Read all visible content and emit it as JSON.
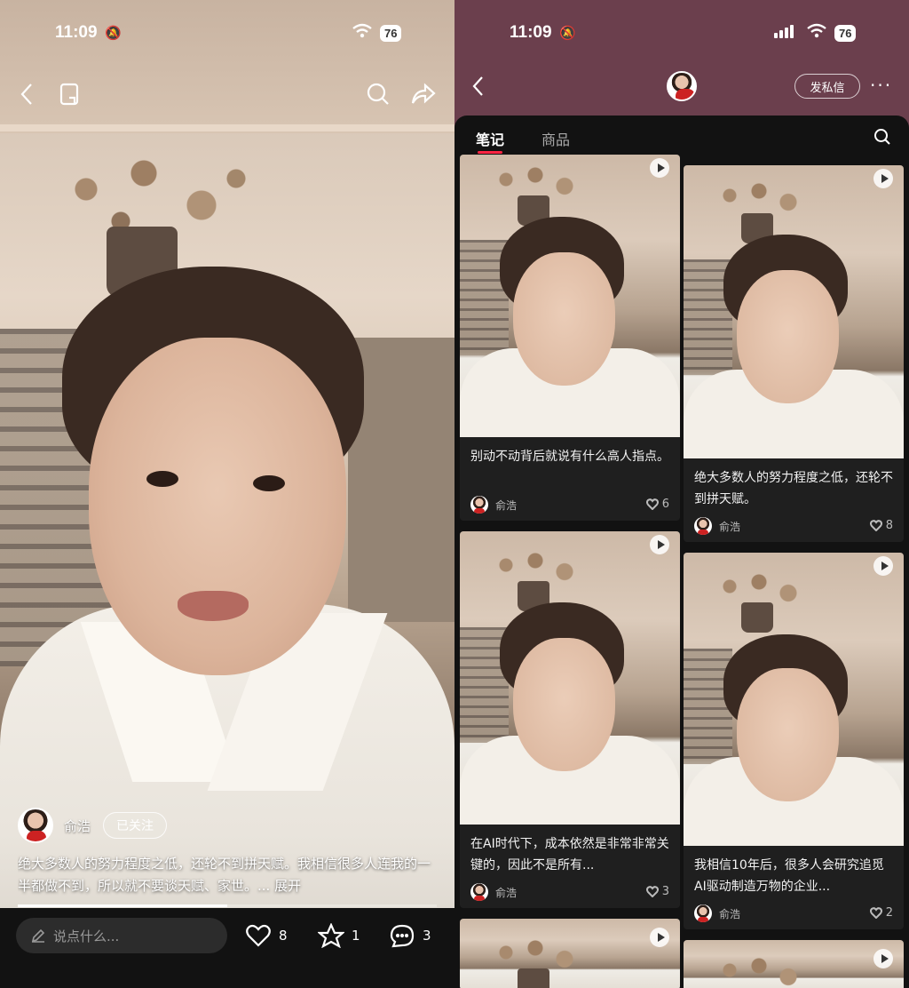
{
  "left": {
    "status": {
      "time": "11:09",
      "battery": "76"
    },
    "author": {
      "name": "俞浩",
      "follow_label": "已关注"
    },
    "description": "绝大多数人的努力程度之低，还轮不到拼天赋。我相信很多人连我的一半都做不到，所以就不要谈天赋、家世。... 展开",
    "progress": 0.5,
    "comment_placeholder": "说点什么...",
    "actions": {
      "likes": "8",
      "collects": "1",
      "comments": "3"
    }
  },
  "right": {
    "status": {
      "time": "11:09",
      "battery": "76"
    },
    "header": {
      "dm_label": "发私信",
      "more": "···"
    },
    "tabs": [
      {
        "label": "笔记"
      },
      {
        "label": "商品"
      }
    ],
    "cards": [
      {
        "title": "别动不动背后就说有什么高人指点。",
        "author": "俞浩",
        "likes": "6"
      },
      {
        "title": "绝大多数人的努力程度之低，还轮不到拼天赋。",
        "author": "俞浩",
        "likes": "8"
      },
      {
        "title": "在AI时代下，成本依然是非常非常关键的，因此不是所有...",
        "author": "俞浩",
        "likes": "3"
      },
      {
        "title": "我相信10年后，很多人会研究追觅AI驱动制造万物的企业...",
        "author": "俞浩",
        "likes": "2"
      }
    ]
  }
}
